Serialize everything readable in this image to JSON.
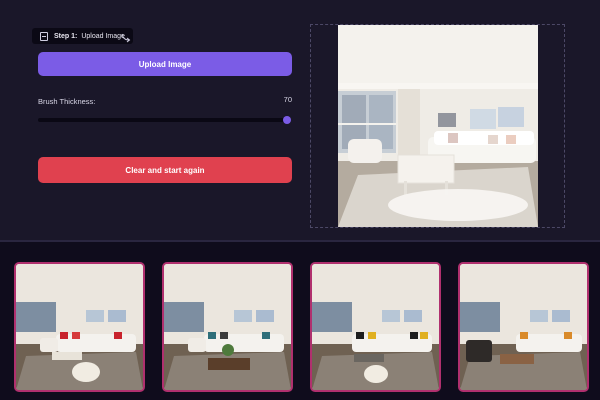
{
  "step": {
    "label": "Step 1:",
    "text": "Upload Image"
  },
  "upload_button": {
    "label": "Upload Image"
  },
  "brush": {
    "label": "Brush Thickness:",
    "value": "70",
    "level": 70,
    "max": 72
  },
  "reset_button": {
    "label": "Clear and start again"
  },
  "colors": {
    "accent": "#7b5ce6",
    "danger": "#e0414f",
    "thumb_border": "#b0306e",
    "panel_bg": "#1a1729",
    "page_bg": "#0f0c1c"
  },
  "results": [
    {
      "variant": "red-cushions"
    },
    {
      "variant": "teal-cushions"
    },
    {
      "variant": "black-yellow-cushions"
    },
    {
      "variant": "orange-cushions"
    }
  ]
}
